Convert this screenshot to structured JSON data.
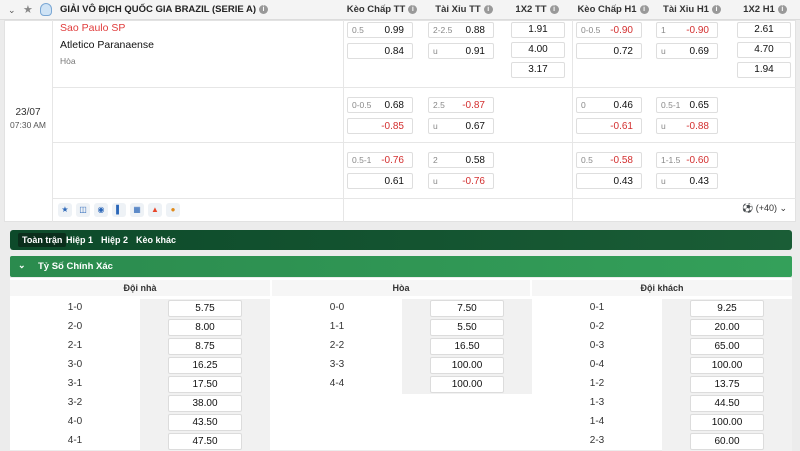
{
  "league": "GIẢI VÔ ĐỊCH QUỐC GIA BRAZIL (SERIE A)",
  "columns": [
    "Kèo Chấp TT",
    "Tài Xỉu TT",
    "1X2 TT",
    "Kèo Chấp H1",
    "Tài Xỉu H1",
    "1X2 H1"
  ],
  "match": {
    "home": "Sao Paulo SP",
    "away": "Atletico Paranaense",
    "draw": "Hòa",
    "date": "23/07",
    "time": "07:30 AM",
    "more": "(+40)"
  },
  "rows": [
    {
      "kc_tt": [
        {
          "h": "0.5",
          "o": "0.99"
        },
        {
          "h": "",
          "o": "0.84"
        }
      ],
      "tx_tt": [
        {
          "h": "2-2.5",
          "o": "0.88"
        },
        {
          "h": "u",
          "o": "0.91"
        }
      ],
      "x12_tt": [
        "1.91",
        "4.00",
        "3.17"
      ],
      "kc_h1": [
        {
          "h": "0-0.5",
          "o": "-0.90"
        },
        {
          "h": "",
          "o": "0.72"
        }
      ],
      "tx_h1": [
        {
          "h": "1",
          "o": "-0.90"
        },
        {
          "h": "u",
          "o": "0.69"
        }
      ],
      "x12_h1": [
        "2.61",
        "4.70",
        "1.94"
      ]
    },
    {
      "kc_tt": [
        {
          "h": "0-0.5",
          "o": "0.68"
        },
        {
          "h": "",
          "o": "-0.85"
        }
      ],
      "tx_tt": [
        {
          "h": "2.5",
          "o": "-0.87"
        },
        {
          "h": "u",
          "o": "0.67"
        }
      ],
      "kc_h1": [
        {
          "h": "0",
          "o": "0.46"
        },
        {
          "h": "",
          "o": "-0.61"
        }
      ],
      "tx_h1": [
        {
          "h": "0.5-1",
          "o": "0.65"
        },
        {
          "h": "u",
          "o": "-0.88"
        }
      ]
    },
    {
      "kc_tt": [
        {
          "h": "0.5-1",
          "o": "-0.76"
        },
        {
          "h": "",
          "o": "0.61"
        }
      ],
      "tx_tt": [
        {
          "h": "2",
          "o": "0.58"
        },
        {
          "h": "u",
          "o": "-0.76"
        }
      ],
      "kc_h1": [
        {
          "h": "0.5",
          "o": "-0.58"
        },
        {
          "h": "",
          "o": "0.43"
        }
      ],
      "tx_h1": [
        {
          "h": "1-1.5",
          "o": "-0.60"
        },
        {
          "h": "u",
          "o": "0.43"
        }
      ]
    }
  ],
  "tabs": [
    "Toàn trận",
    "Hiệp 1",
    "Hiệp 2",
    "Kèo khác"
  ],
  "section_title": "Tỷ Số Chính Xác",
  "cs_headers": [
    "Đội nhà",
    "Hòa",
    "Đội khách"
  ],
  "cs_home": [
    [
      "1-0",
      "5.75"
    ],
    [
      "2-0",
      "8.00"
    ],
    [
      "2-1",
      "8.75"
    ],
    [
      "3-0",
      "16.25"
    ],
    [
      "3-1",
      "17.50"
    ],
    [
      "3-2",
      "38.00"
    ],
    [
      "4-0",
      "43.50"
    ],
    [
      "4-1",
      "47.50"
    ]
  ],
  "cs_draw": [
    [
      "0-0",
      "7.50"
    ],
    [
      "1-1",
      "5.50"
    ],
    [
      "2-2",
      "16.50"
    ],
    [
      "3-3",
      "100.00"
    ],
    [
      "4-4",
      "100.00"
    ]
  ],
  "cs_away": [
    [
      "0-1",
      "9.25"
    ],
    [
      "0-2",
      "20.00"
    ],
    [
      "0-3",
      "65.00"
    ],
    [
      "0-4",
      "100.00"
    ],
    [
      "1-2",
      "13.75"
    ],
    [
      "1-3",
      "44.50"
    ],
    [
      "1-4",
      "100.00"
    ],
    [
      "2-3",
      "60.00"
    ]
  ],
  "colors": {
    "neg": "#d32f2f",
    "home_team": "#e03c3c",
    "tabs_bg": "#0d4a2a",
    "section_bg": "#2b8b4e"
  }
}
